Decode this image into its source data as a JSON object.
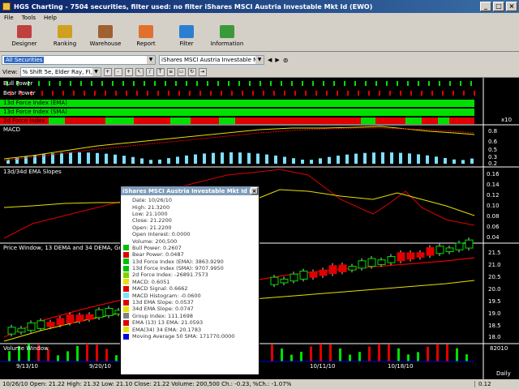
{
  "window": {
    "title": "HGS Charting - 7504 securities, filter used: no filter      iShares MSCI Austria Investable Mkt Id (EWO)"
  },
  "menu": [
    "File",
    "Tools",
    "Help"
  ],
  "toolbar": [
    {
      "label": "Designer",
      "icon": "designer-icon",
      "color": "#c04040"
    },
    {
      "label": "Ranking",
      "icon": "ranking-icon",
      "color": "#d0a020"
    },
    {
      "label": "Warehouse",
      "icon": "warehouse-icon",
      "color": "#a06030"
    },
    {
      "label": "Report",
      "icon": "report-icon",
      "color": "#e07030"
    },
    {
      "label": "Filter",
      "icon": "filter-icon",
      "color": "#2a7fd0"
    },
    {
      "label": "Information",
      "icon": "information-icon",
      "color": "#3a9a3a"
    }
  ],
  "selection": {
    "list_value": "All Securities",
    "security_value": "iShares MSCI Austria Investable Mkt Id"
  },
  "view": {
    "label": "View:",
    "value": "% Shift 5e, Elder Ray, FI, 1"
  },
  "panels": {
    "bull_power": "Bull Power",
    "bear_power": "Bear Power",
    "fi13_ema": "13d Force Index (EMA)",
    "fi13_sma": "13d Force Index (SMA)",
    "fi2": "2d Force Index",
    "macd": "MACD",
    "slopes": "13d/34d EMA Slopes",
    "price": "Price Window, 13 DEMA and 34 DEMA, Group",
    "volume": "Volume Window"
  },
  "axis_labels": {
    "macd": [
      "0.8",
      "0.6",
      "0.5",
      "0.3",
      "0.2"
    ],
    "slopes": [
      "0.16",
      "0.14",
      "0.12",
      "0.10",
      "0.08",
      "0.06",
      "0.04"
    ],
    "price": [
      "21.5",
      "21.0",
      "20.5",
      "20.0",
      "19.5",
      "19.0",
      "18.5",
      "18.0"
    ],
    "x10": "x10",
    "volume_top": "82010",
    "dates": [
      "9/13/10",
      "9/20/10",
      "10/11/10",
      "10/18/10"
    ],
    "daily": "Daily"
  },
  "status": {
    "ohlc": "10/26/10 Open: 21.22 High: 21.32 Low: 21.10 Close: 21.22 Volume: 200,500 Ch.: -0.23, %Ch.: -1.07%",
    "value": "0.12"
  },
  "popup": {
    "title": "iShares MSCI Austria Investable Mkt Id (E...",
    "rows": [
      {
        "text": "Date: 10/26/10",
        "color": ""
      },
      {
        "text": "High: 21.3200",
        "color": ""
      },
      {
        "text": "Low: 21.1000",
        "color": ""
      },
      {
        "text": "Close: 21.2200",
        "color": ""
      },
      {
        "text": "Open: 21.2200",
        "color": ""
      },
      {
        "text": "Open Interest: 0.0000",
        "color": ""
      },
      {
        "text": "Volume: 200,500",
        "color": ""
      },
      {
        "text": "Bull Power: 0.2607",
        "color": "#00c000"
      },
      {
        "text": "Bear Power: 0.0487",
        "color": "#e00000"
      },
      {
        "text": "13d Force Index (EMA): 3863.9290",
        "color": "#00c000"
      },
      {
        "text": "13d Force Index (SMA): 9707.9950",
        "color": "#00c000"
      },
      {
        "text": "2d Force Index: -26891.7573",
        "color": "#80d000"
      },
      {
        "text": "MACD: 0.6051",
        "color": "#e8e000"
      },
      {
        "text": "MACD Signal: 0.6662",
        "color": "#e00000"
      },
      {
        "text": "MACD Histogram: -0.0600",
        "color": "#80e0ff"
      },
      {
        "text": "13d EMA Slope: 0.0537",
        "color": "#e00000"
      },
      {
        "text": "34d EMA Slope: 0.0747",
        "color": "#e8e000"
      },
      {
        "text": "Group Index: 111.1698",
        "color": "#808080"
      },
      {
        "text": "EMA (13) 13 EMA: 21.0593",
        "color": "#e00000"
      },
      {
        "text": "EMA(34) 34 EMA: 20.1783",
        "color": "#e8e000"
      },
      {
        "text": "Moving Average 50 SMA: 171770.0000",
        "color": "#0000e0"
      }
    ]
  },
  "colors": {
    "bull": "#00e000",
    "bear": "#e00000",
    "macd_line": "#e8e000",
    "signal_line": "#e00000",
    "histogram": "#80e0ff"
  }
}
